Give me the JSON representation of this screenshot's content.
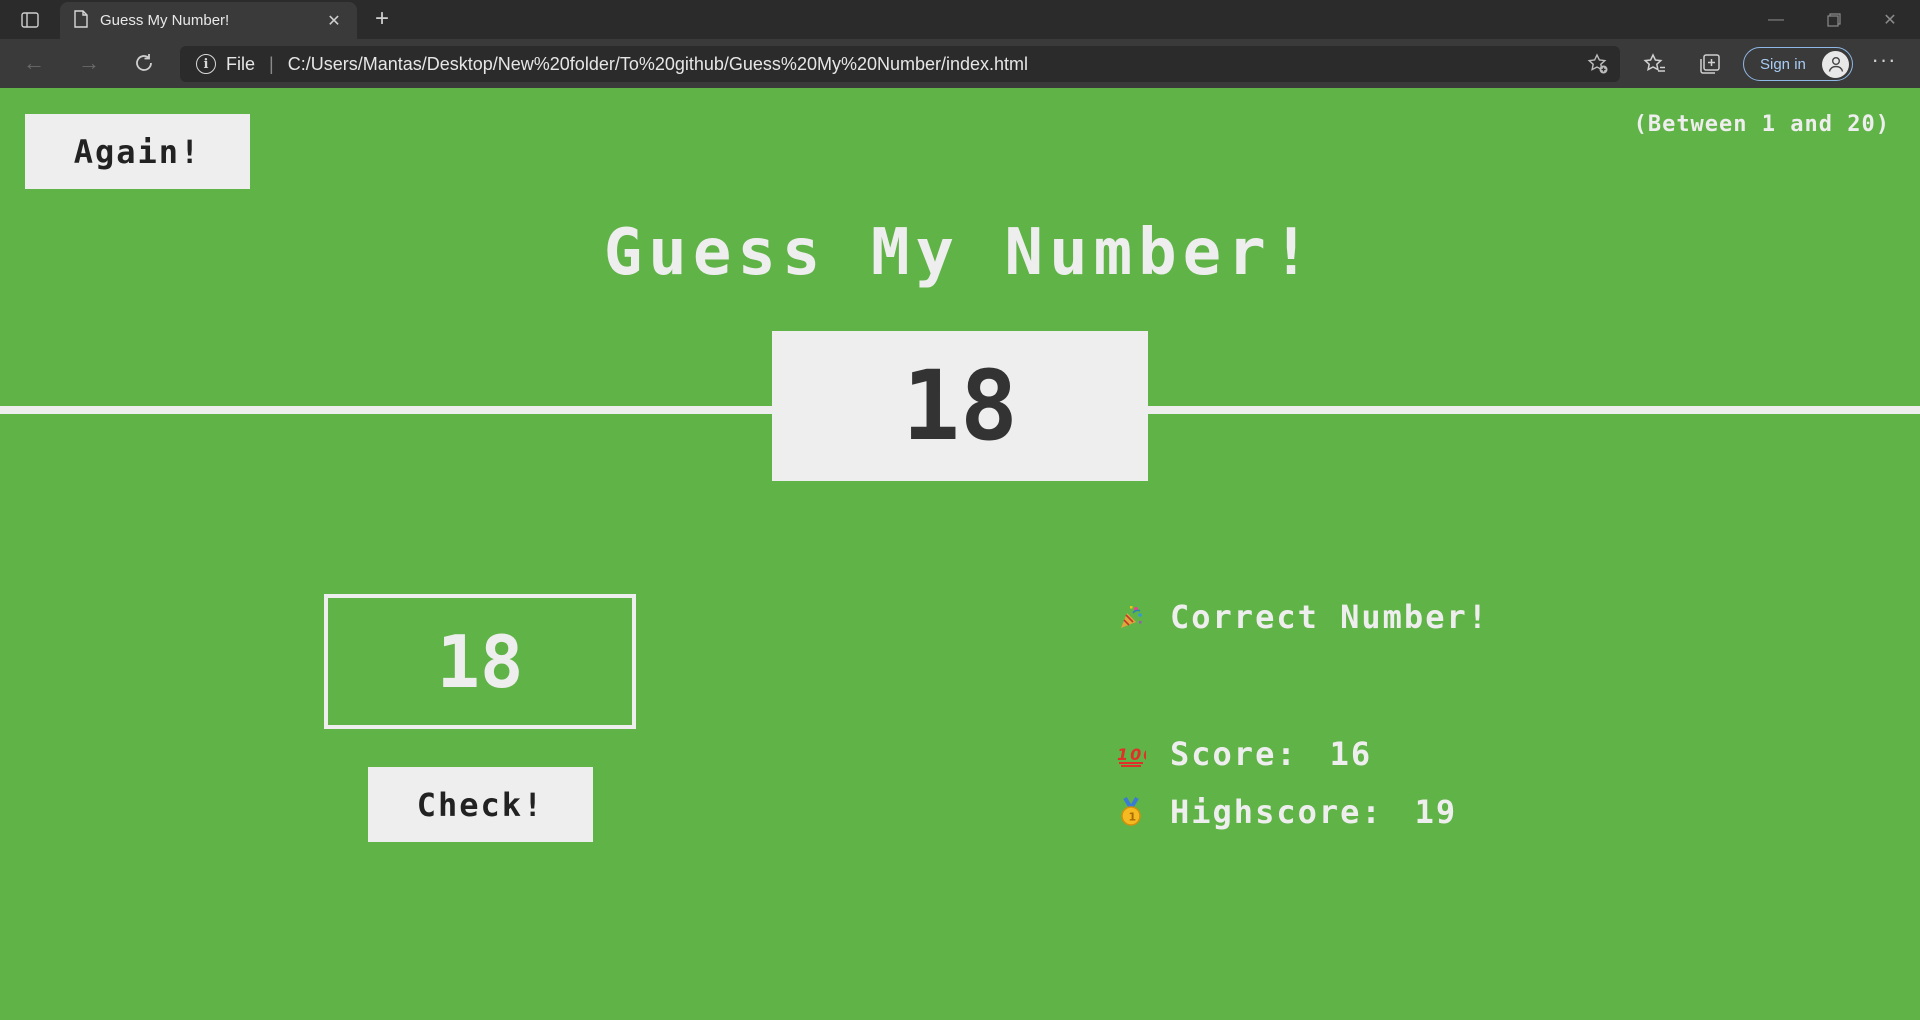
{
  "browser": {
    "tab": {
      "title": "Guess My Number!"
    },
    "address": {
      "scheme": "File",
      "url": "C:/Users/Mantas/Desktop/New%20folder/To%20github/Guess%20My%20Number/index.html"
    },
    "signin_label": "Sign in"
  },
  "page": {
    "again_label": "Again!",
    "range_hint": "(Between 1 and 20)",
    "title": "Guess My Number!",
    "secret_number": "18",
    "guess_value": "18",
    "check_label": "Check!",
    "message": "Correct Number!",
    "score_label": "Score:",
    "score_value": "16",
    "highscore_label": "Highscore:",
    "highscore_value": "19"
  },
  "colors": {
    "win_background": "#60b347",
    "panel": "#eeeeee",
    "dark_text": "#333333"
  }
}
